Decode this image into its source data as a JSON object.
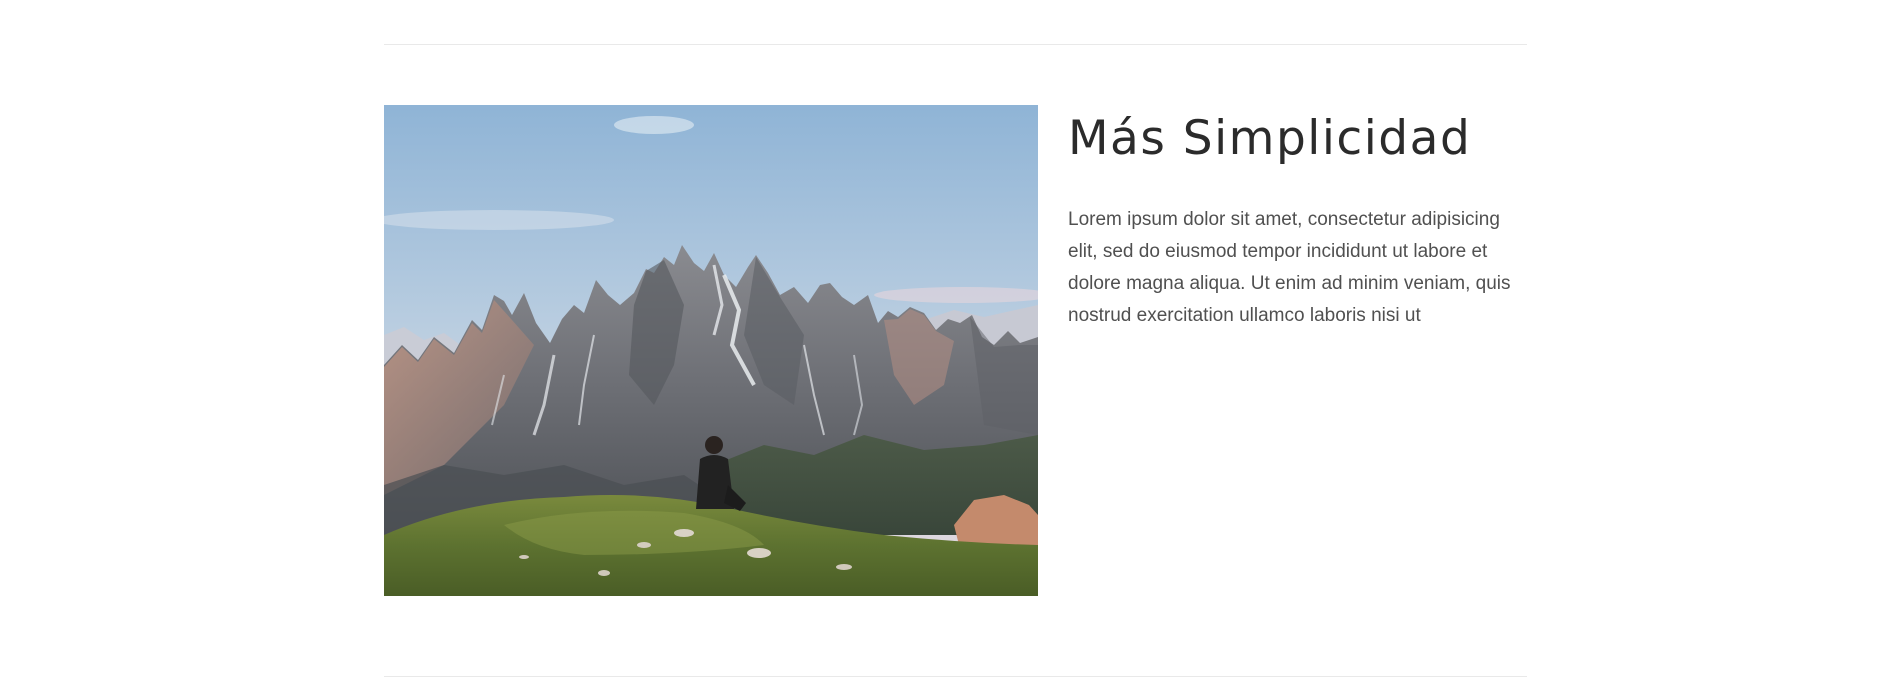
{
  "feature": {
    "title": "Más Simplicidad",
    "body": "Lorem ipsum dolor sit amet, consectetur adipisicing elit, sed do eiusmod tempor incididunt ut labore et dolore magna aliqua. Ut enim ad minim veniam, quis nostrud exercitation ullamco laboris nisi ut",
    "image_icon": "mountain-landscape-photo"
  },
  "colors": {
    "divider": "#e9e9e9",
    "title": "#2b2b2b",
    "body": "#505050",
    "background": "#ffffff"
  }
}
